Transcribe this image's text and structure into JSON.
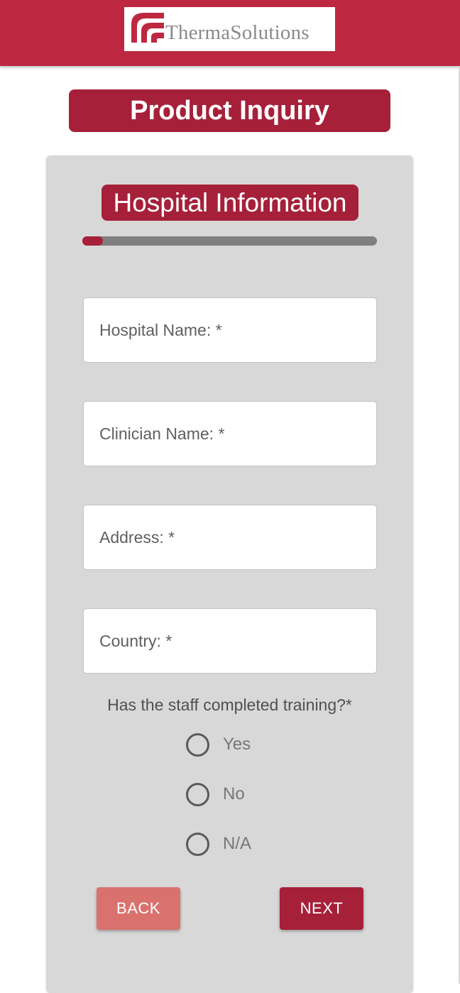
{
  "brand": {
    "logo_text": "ThermaSolutions",
    "primary_color": "#bd2840",
    "accent_color": "#a6203a"
  },
  "page": {
    "title": "Product Inquiry"
  },
  "form": {
    "section_title": "Hospital Information",
    "progress": 0.07,
    "fields": {
      "hospital_name": {
        "placeholder": "Hospital Name: *",
        "value": ""
      },
      "clinician_name": {
        "placeholder": "Clinician Name: *",
        "value": ""
      },
      "address": {
        "placeholder": "Address: *",
        "value": ""
      },
      "country": {
        "placeholder": "Country: *",
        "value": ""
      }
    },
    "question": "Has the staff completed training?*",
    "options": [
      "Yes",
      "No",
      "N/A"
    ],
    "selected_option": null
  },
  "actions": {
    "back_label": "BACK",
    "next_label": "NEXT",
    "back_color": "#d9726d"
  }
}
